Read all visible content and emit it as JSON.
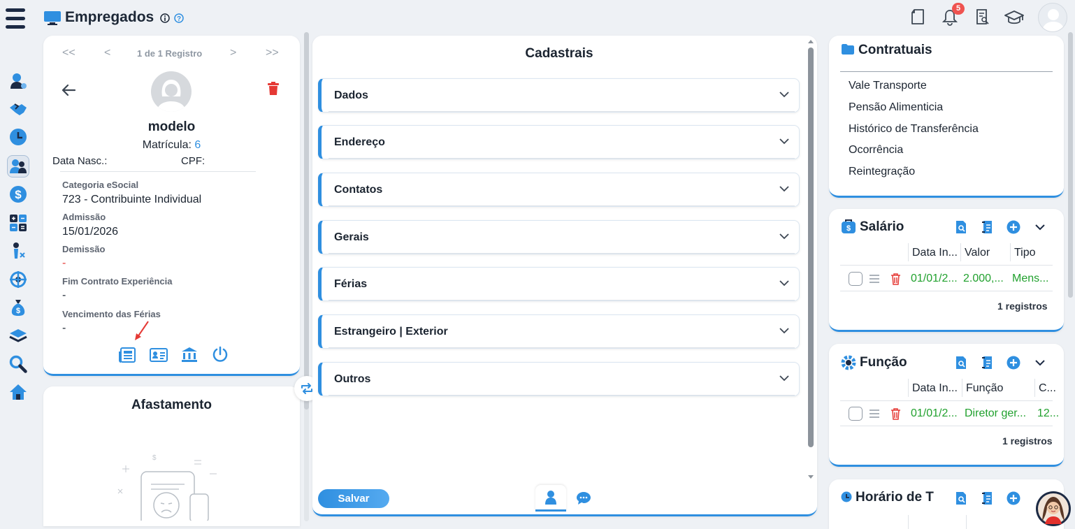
{
  "header": {
    "title": "Empregados",
    "notifications_count": "5"
  },
  "record_nav": {
    "first": "<<",
    "prev": "<",
    "label": "1 de 1 Registro",
    "next": ">",
    "last": ">>"
  },
  "employee": {
    "name": "modelo",
    "matricula_label": "Matrícula:",
    "matricula_value": "6",
    "data_nasc_label": "Data Nasc.:",
    "cpf_label": "CPF:",
    "fields": [
      {
        "label": "Categoria eSocial",
        "value": "723 - Contribuinte Individual"
      },
      {
        "label": "Admissão",
        "value": "15/01/2026"
      },
      {
        "label": "Demissão",
        "value": "-"
      },
      {
        "label": "Fim Contrato Experiência",
        "value": "-"
      },
      {
        "label": "Vencimento das Férias",
        "value": "-"
      }
    ]
  },
  "afastamento": {
    "title": "Afastamento"
  },
  "cadastrais": {
    "title": "Cadastrais",
    "sections": [
      "Dados",
      "Endereço",
      "Contatos",
      "Gerais",
      "Férias",
      "Estrangeiro | Exterior",
      "Outros"
    ],
    "save_label": "Salvar"
  },
  "contratuais": {
    "title": "Contratuais",
    "items": [
      "Vale Transporte",
      "Pensão Alimenticia",
      "Histórico de Transferência",
      "Ocorrência",
      "Reintegração"
    ]
  },
  "salario": {
    "title": "Salário",
    "columns": [
      "Data In...",
      "Valor",
      "Tipo"
    ],
    "rows": [
      {
        "data": "01/01/2...",
        "valor": "2.000,...",
        "tipo": "Mens..."
      }
    ],
    "count": "1 registros"
  },
  "funcao": {
    "title": "Função",
    "columns": [
      "Data In...",
      "Função",
      "C..."
    ],
    "rows": [
      {
        "data": "01/01/2...",
        "funcao": "Diretor ger...",
        "c": "12..."
      }
    ],
    "count": "1 registros"
  },
  "horario": {
    "title": "Horário de T"
  },
  "colors": {
    "accent": "#2f8fe0",
    "danger": "#e53935",
    "success": "#21a12e",
    "text": "#1b2430"
  }
}
